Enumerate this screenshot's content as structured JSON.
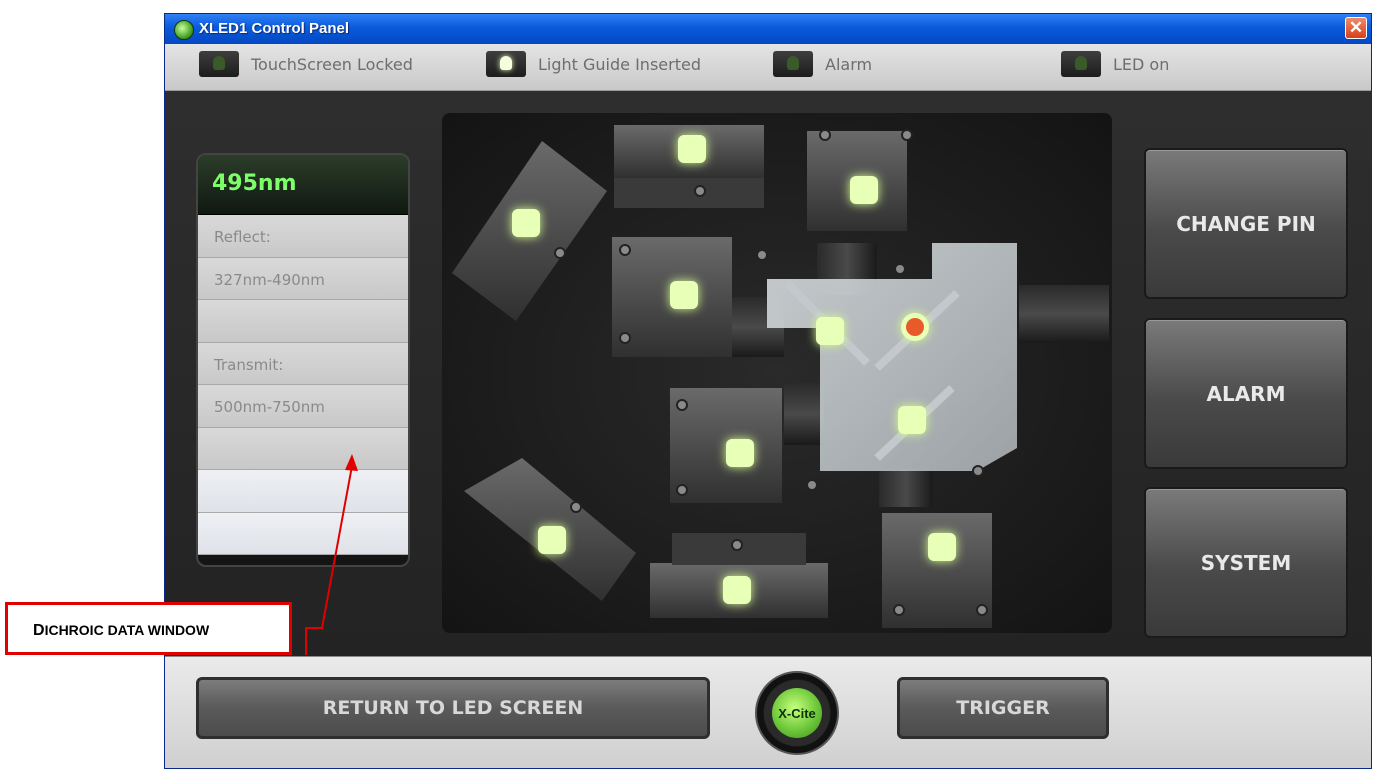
{
  "window": {
    "title": "XLED1 Control Panel",
    "close_glyph": "✕"
  },
  "status_indicators": [
    {
      "label": "TouchScreen Locked",
      "on": false
    },
    {
      "label": "Light Guide Inserted",
      "on": true
    },
    {
      "label": "Alarm",
      "on": false
    },
    {
      "label": "LED on",
      "on": false
    }
  ],
  "dichroic": {
    "wavelength": "495nm",
    "reflect_label": "Reflect:",
    "reflect_value": "327nm-490nm",
    "transmit_label": "Transmit:",
    "transmit_value": "500nm-750nm"
  },
  "side_buttons": {
    "change_pin": "CHANGE PIN",
    "alarm": "ALARM",
    "system": "SYSTEM"
  },
  "bottom": {
    "return": "RETURN TO LED SCREEN",
    "logo": "X-Cite",
    "trigger": "TRIGGER"
  },
  "annotation": {
    "first": "D",
    "rest": "ICHROIC DATA WINDOW"
  },
  "colors": {
    "led_idle": "#e8ffb8",
    "led_selected": "#e85a2a",
    "accent_green": "#7dff6a",
    "annotation_red": "#e00000"
  }
}
